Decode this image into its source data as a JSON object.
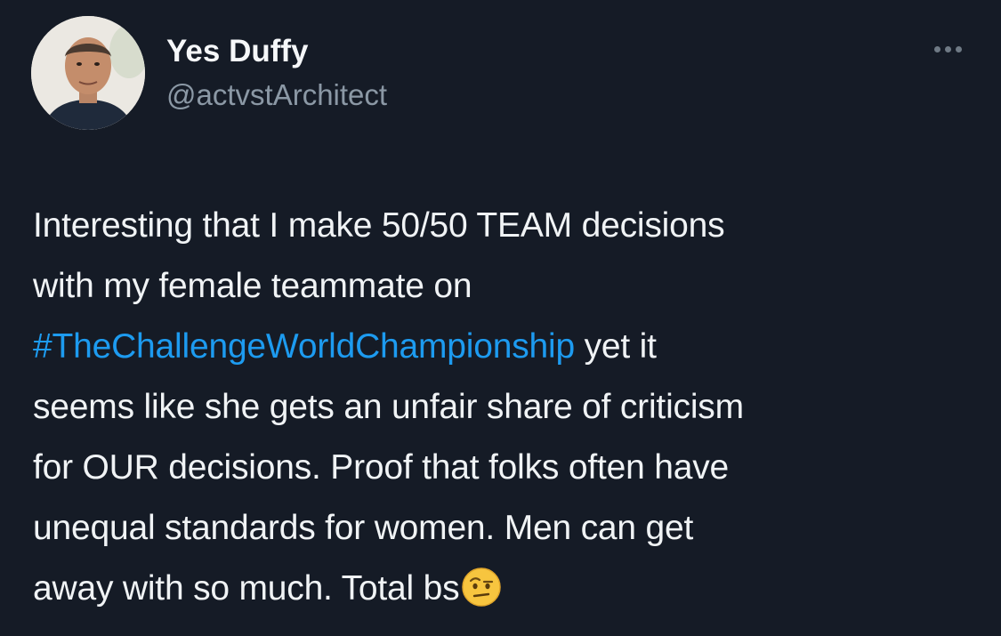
{
  "tweet": {
    "author": {
      "display_name": "Yes Duffy",
      "handle": "@actvstArchitect",
      "avatar_icon": "profile-photo"
    },
    "more_icon": "more-horizontal-icon",
    "body": {
      "line1": "Interesting that I make 50/50 TEAM  decisions",
      "line2": "with my female teammate on",
      "hashtag": "#TheChallengeWorldChampionship",
      "line3_rest": " yet it",
      "line4": "seems like she gets an unfair share of criticism",
      "line5": "for OUR decisions. Proof that folks often have",
      "line6": "unequal standards for women. Men can get",
      "line7": "away with so much. Total bs",
      "emoji_icon": "raised-eyebrow-face-emoji"
    }
  },
  "colors": {
    "background": "#151b26",
    "text": "#f0f3f5",
    "handle": "#8b98a5",
    "hashtag": "#1d9bf0"
  }
}
